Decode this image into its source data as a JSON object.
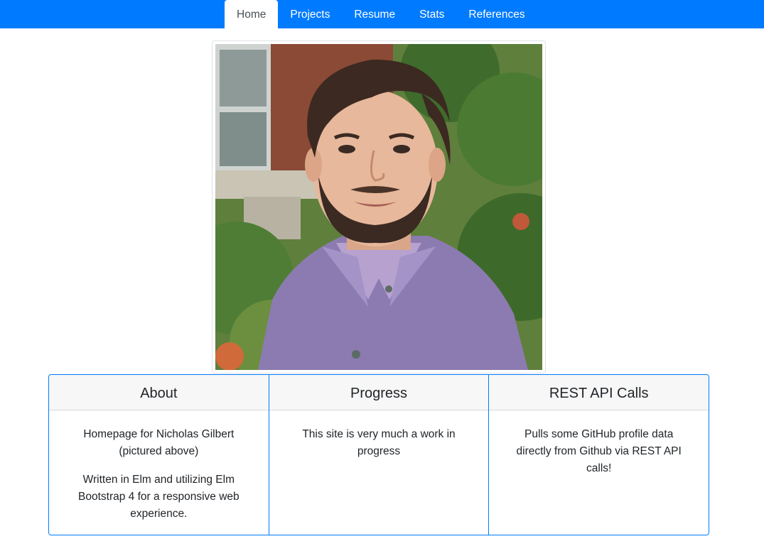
{
  "nav": {
    "tabs": [
      {
        "label": "Home",
        "active": true
      },
      {
        "label": "Projects",
        "active": false
      },
      {
        "label": "Resume",
        "active": false
      },
      {
        "label": "Stats",
        "active": false
      },
      {
        "label": "References",
        "active": false
      }
    ]
  },
  "colors": {
    "primary": "#007bff",
    "card_header_bg": "#f7f7f7",
    "text": "#212529"
  },
  "cards": [
    {
      "title": "About",
      "paragraphs": [
        "Homepage for Nicholas Gilbert (pictured above)",
        "Written in Elm and utilizing Elm Bootstrap 4 for a responsive web experience."
      ]
    },
    {
      "title": "Progress",
      "paragraphs": [
        "This site is very much a work in progress"
      ]
    },
    {
      "title": "REST API Calls",
      "paragraphs": [
        "Pulls some GitHub profile data directly from Github via REST API calls!"
      ]
    }
  ]
}
